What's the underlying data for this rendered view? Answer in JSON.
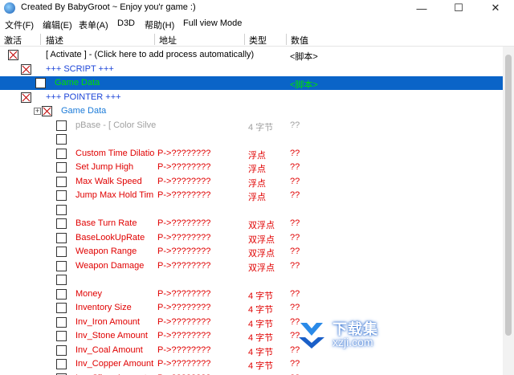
{
  "window": {
    "title": "Created By BabyGroot  ~ Enjoy you'r game :)",
    "minimize": "—",
    "maximize": "☐",
    "close": "✕"
  },
  "menu": [
    "文件(F)",
    "编辑(E)",
    "表单(A)",
    "D3D",
    "帮助(H)",
    "Full view Mode"
  ],
  "columns": {
    "active": "激活",
    "description": "描述",
    "address": "地址",
    "type": "类型",
    "value": "数值"
  },
  "rows": [
    {
      "check": "x",
      "desc": "[ Activate ] - (Click here to add process automatically)",
      "addr": "",
      "type": "",
      "value": "<脚本>",
      "color": "black",
      "indent": 0
    },
    {
      "check": "x",
      "desc": "+++ SCRIPT +++",
      "addr": "",
      "type": "",
      "value": "",
      "color": "blue",
      "indent": 1
    },
    {
      "check": "empty",
      "desc": "Game Data",
      "addr": "",
      "type": "",
      "value": "<脚本>",
      "color": "green",
      "indent": 2,
      "selected": true
    },
    {
      "check": "x",
      "desc": "+++ POINTER +++",
      "addr": "",
      "type": "",
      "value": "",
      "color": "blue",
      "indent": 1
    },
    {
      "check": "x",
      "desc": "Game Data",
      "addr": "",
      "type": "",
      "value": "",
      "color": "blue2",
      "indent": 2,
      "expander": "+"
    },
    {
      "check": "empty",
      "desc": "pBase - [ Color Silve([pBase_Game]]",
      "addr": "",
      "type": "4 字节",
      "value": "??",
      "color": "gray",
      "indent": 3
    },
    {
      "check": "empty",
      "desc": "",
      "addr": "",
      "type": "",
      "value": "",
      "color": "red",
      "indent": 3
    },
    {
      "check": "empty",
      "desc": "Custom Time Dilatio",
      "addr": "P->????????",
      "type": "浮点",
      "value": "??",
      "color": "red",
      "indent": 3
    },
    {
      "check": "empty",
      "desc": "Set Jump High",
      "addr": "P->????????",
      "type": "浮点",
      "value": "??",
      "color": "red",
      "indent": 3
    },
    {
      "check": "empty",
      "desc": "Max Walk Speed",
      "addr": "P->????????",
      "type": "浮点",
      "value": "??",
      "color": "red",
      "indent": 3
    },
    {
      "check": "empty",
      "desc": "Jump Max Hold Tim",
      "addr": "P->????????",
      "type": "浮点",
      "value": "??",
      "color": "red",
      "indent": 3
    },
    {
      "check": "empty",
      "desc": "",
      "addr": "",
      "type": "",
      "value": "",
      "color": "red",
      "indent": 3
    },
    {
      "check": "empty",
      "desc": "Base Turn Rate",
      "addr": "P->????????",
      "type": "双浮点",
      "value": "??",
      "color": "red",
      "indent": 3
    },
    {
      "check": "empty",
      "desc": "BaseLookUpRate",
      "addr": "P->????????",
      "type": "双浮点",
      "value": "??",
      "color": "red",
      "indent": 3
    },
    {
      "check": "empty",
      "desc": "Weapon Range",
      "addr": "P->????????",
      "type": "双浮点",
      "value": "??",
      "color": "red",
      "indent": 3
    },
    {
      "check": "empty",
      "desc": "Weapon Damage",
      "addr": "P->????????",
      "type": "双浮点",
      "value": "??",
      "color": "red",
      "indent": 3
    },
    {
      "check": "empty",
      "desc": "",
      "addr": "",
      "type": "",
      "value": "",
      "color": "red",
      "indent": 3
    },
    {
      "check": "empty",
      "desc": "Money",
      "addr": "P->????????",
      "type": "4 字节",
      "value": "??",
      "color": "red",
      "indent": 3
    },
    {
      "check": "empty",
      "desc": "Inventory Size",
      "addr": "P->????????",
      "type": "4 字节",
      "value": "??",
      "color": "red",
      "indent": 3
    },
    {
      "check": "empty",
      "desc": "Inv_Iron Amount",
      "addr": "P->????????",
      "type": "4 字节",
      "value": "??",
      "color": "red",
      "indent": 3
    },
    {
      "check": "empty",
      "desc": "Inv_Stone Amount",
      "addr": "P->????????",
      "type": "4 字节",
      "value": "??",
      "color": "red",
      "indent": 3
    },
    {
      "check": "empty",
      "desc": "Inv_Coal Amount",
      "addr": "P->????????",
      "type": "4 字节",
      "value": "??",
      "color": "red",
      "indent": 3
    },
    {
      "check": "empty",
      "desc": "Inv_Copper Amount",
      "addr": "P->????????",
      "type": "4 字节",
      "value": "??",
      "color": "red",
      "indent": 3
    },
    {
      "check": "empty",
      "desc": "Inv_Silver Amount",
      "addr": "P->????????",
      "type": "4 字节",
      "value": "??",
      "color": "red",
      "indent": 3
    }
  ],
  "watermark": {
    "title": "下载集",
    "url": "xzji.com"
  }
}
